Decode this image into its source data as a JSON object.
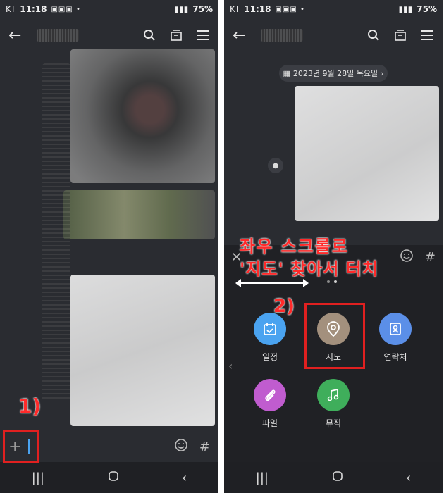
{
  "status": {
    "carrier": "KT",
    "time": "11:18",
    "battery": "75%"
  },
  "left_screen": {
    "step_label": "1)"
  },
  "right_screen": {
    "date_pill": "2023년 9월 28일 목요일",
    "annotation_line1": "좌우 스크롤로",
    "annotation_line2": "'지도' 찾아서 터치",
    "step_label": "2)",
    "attachments": [
      {
        "label": "일정",
        "color": "#4aa3f0",
        "icon": "calendar-icon"
      },
      {
        "label": "지도",
        "color": "#a3907d",
        "icon": "map-pin-icon"
      },
      {
        "label": "연락처",
        "color": "#5b8fe8",
        "icon": "contact-icon"
      },
      {
        "label": "파일",
        "color": "#c05ccf",
        "icon": "paperclip-icon"
      },
      {
        "label": "뮤직",
        "color": "#3fae5b",
        "icon": "music-note-icon"
      }
    ]
  },
  "colors": {
    "annotation_red": "#e02020",
    "bg_dark": "#2a2c31",
    "panel": "#202125"
  }
}
